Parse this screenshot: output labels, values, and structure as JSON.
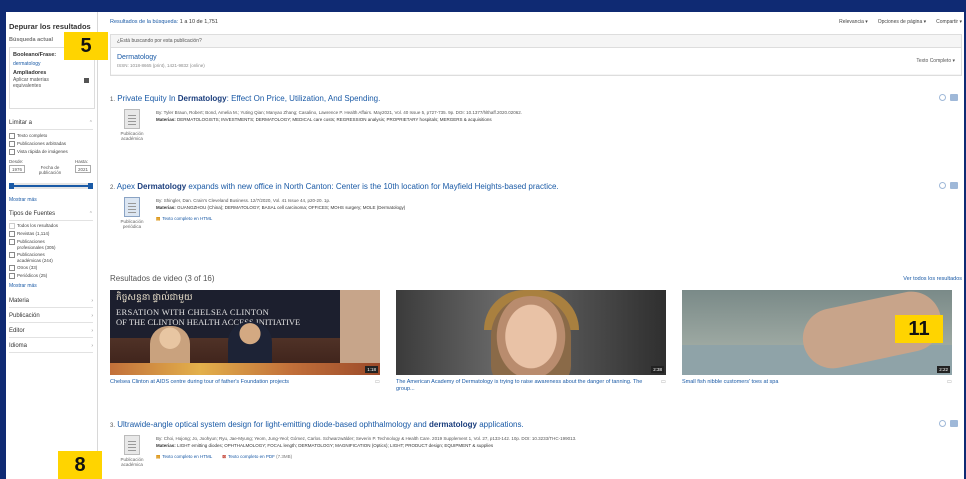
{
  "sidebar": {
    "title": "Depurar los resultados",
    "current_search": "Búsqueda actual",
    "boolean_label": "Booleano/Frase:",
    "boolean_value": "dermatology",
    "expanders_label": "Ampliadores",
    "expander_item": "Aplicar materias equivalentes",
    "limit_label": "Limitar a",
    "limits": [
      "Texto completo",
      "Publicaciones arbitradas",
      "Vista rápida de imágenes"
    ],
    "date_from_label": "Desde:",
    "date_to_label": "Hasta:",
    "date_from": "1976",
    "date_to": "2021",
    "date_center": "Fecha de publicación",
    "date_range": [
      1976,
      2021
    ],
    "show_more_1": "Mostrar más",
    "source_types_label": "Tipos de Fuentes",
    "source_types": [
      "Todos los resultados",
      "Revistas (1,114)",
      "Publicaciones profesionales (305)",
      "Publicaciones académicas (244)",
      "Otros (33)",
      "Periódicos (25)"
    ],
    "show_more_2": "Mostrar más",
    "facets": [
      "Materia",
      "Publicación",
      "Editor",
      "Idioma"
    ]
  },
  "topbar": {
    "results_label": "Resultados de la búsqueda:",
    "results_range": "1 a 10 de 1,751",
    "relevance": "Relevancia ▾",
    "page_options": "Opciones de página ▾",
    "share": "Compartir ▾"
  },
  "pub_finder": {
    "question": "¿Está buscando por esta publicación?",
    "title": "Dermatology",
    "issn": "ISSN: 1018-8665 (print), 1421-9832 (online)",
    "full_text": "Texto Completo ▾"
  },
  "results": [
    {
      "num": "1.",
      "title_pre": "Private Equity In ",
      "title_bold": "Dermatology",
      "title_post": ": Effect On Price, Utilization, And Spending.",
      "by": "By: Tyler Braun, Robert; Bond, Amelia M.; Yuting Qian; Manyao Zhang; Casalino, Lawrence P. Health Affairs. May2021, Vol. 40 Issue 5, p727-735. 9p. DOI: 10.1377/hlthaff.2020.02062.",
      "subjects_label": "Materias:",
      "subjects": "DERMATOLOGISTS; INVESTMENTS; DERMATOLOGY; MEDICAL care costs; REGRESSION analysis; PROPRIETARY hospitals; MERGERS & acquisitions",
      "type": "Publicación académica"
    },
    {
      "num": "2.",
      "title_pre": "Apex ",
      "title_bold": "Dermatology",
      "title_post": " expands with new office in North Canton: Center is the 10th location for Mayfield Heights-based practice.",
      "by": "By: Shingler, Dan. Crain's Cleveland Business. 12/7/2020, Vol. 41 Issue 44, p20-20. 1p.",
      "subjects_label": "Materias:",
      "subjects": "GUANGZHOU (China); DERMATOLOGY; BASAL cell carcinoma; OFFICES; MOHS surgery; MOLE (Dermatology)",
      "type": "Publicación periódica",
      "link_html": "Texto completo en HTML"
    },
    {
      "num": "3.",
      "title_pre": "Ultrawide-angle optical system design for light-emitting diode-based ophthalmology and ",
      "title_bold": "dermatology",
      "title_post": " applications.",
      "by": "By: Choi, Hojong; Jo, Joohyun; Ryu, Jae-Myung; Yeom, Jung-Yeol; Gómez, Carlos. Schwarzwälder; Severin P. Technology & Health Care. 2019 Supplement 1, Vol. 27, p133-142. 10p. DOI: 10.3233/THC-199013.",
      "subjects_label": "Materias:",
      "subjects": "LIGHT emitting diodes; OPHTHALMOLOGY; FOCAL length; DERMATOLOGY; MAGNIFICATION (Optics); LIGHT; PRODUCT design; EQUIPMENT & supplies",
      "type": "Publicación académica",
      "link_html": "Texto completo en HTML",
      "link_pdf": "Texto completo en PDF",
      "pdf_size": "(7.3MB)"
    }
  ],
  "videos": {
    "title": "Resultados de video (3 of 16)",
    "view_all": "Ver todos los resultados",
    "items": [
      {
        "caption": "Chelsea Clinton at AIDS centre during tour of father's Foundation projects",
        "duration": "1:18",
        "thumb_text_1": "កិច្ចសន្ទនា ផ្ទាល់ជាមួយ",
        "thumb_text_2": "ERSATION WITH CHELSEA CLINTON",
        "thumb_text_3": "OF THE CLINTON HEALTH ACCESS INITIATIVE"
      },
      {
        "caption": "The American Academy of Dermatology is trying to raise awareness about the danger of tanning. The group...",
        "duration": "2:38"
      },
      {
        "caption": "Small fish nibble customers' toes at spa",
        "duration": "2:22"
      }
    ]
  },
  "badges": [
    "5",
    "11",
    "8"
  ]
}
